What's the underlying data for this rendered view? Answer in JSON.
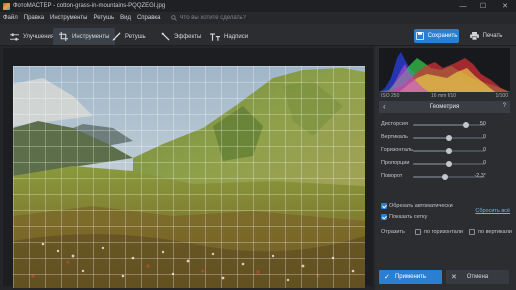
{
  "window": {
    "title": "ФотоМАСТЕР - cotton-grass-in-mountains-PQQZEGI.jpg",
    "minimize": "—",
    "maximize": "☐",
    "close": "✕"
  },
  "menu": {
    "items": [
      "Файл",
      "Правка",
      "Инструменты",
      "Ретушь",
      "Вид",
      "Справка"
    ],
    "search_placeholder": "Что вы хотите сделать?"
  },
  "toolbar": {
    "tabs": [
      {
        "label": "Улучшения",
        "icon": "sliders-icon"
      },
      {
        "label": "Инструменты",
        "icon": "crop-icon"
      },
      {
        "label": "Ретушь",
        "icon": "brush-icon"
      },
      {
        "label": "Эффекты",
        "icon": "magic-wand-icon"
      },
      {
        "label": "Надписи",
        "icon": "text-icon"
      }
    ],
    "active_tab": "Инструменты",
    "save_label": "Сохранить",
    "print_label": "Печать"
  },
  "histogram": {
    "iso": "ISO 250",
    "lens": "16 mm f/10",
    "shutter": "1/100"
  },
  "geometry": {
    "title": "Геометрия",
    "help": "?",
    "back": "‹",
    "sliders": [
      {
        "label": "Дисторсия",
        "value": "50",
        "level": 0.74
      },
      {
        "label": "Вертикаль",
        "value": "0",
        "level": 0.5
      },
      {
        "label": "Горизонталь",
        "value": "0",
        "level": 0.5
      },
      {
        "label": "Пропорции",
        "value": "0",
        "level": 0.5
      },
      {
        "label": "Поворот",
        "value": "-2,3°",
        "level": 0.45
      }
    ],
    "flip_label": "Отразить",
    "flip_horizontal": "по горизонтали",
    "flip_vertical": "по вертикали",
    "auto_crop": "Обрезать автоматически",
    "auto_crop_checked": true,
    "show_grid": "Показать сетку",
    "show_grid_checked": true,
    "reset": "Сбросить всё",
    "apply": "Применить",
    "cancel": "Отмена"
  },
  "colors": {
    "accent": "#2b7fd2",
    "panel": "#2b2d31",
    "dark": "#1e2024"
  }
}
